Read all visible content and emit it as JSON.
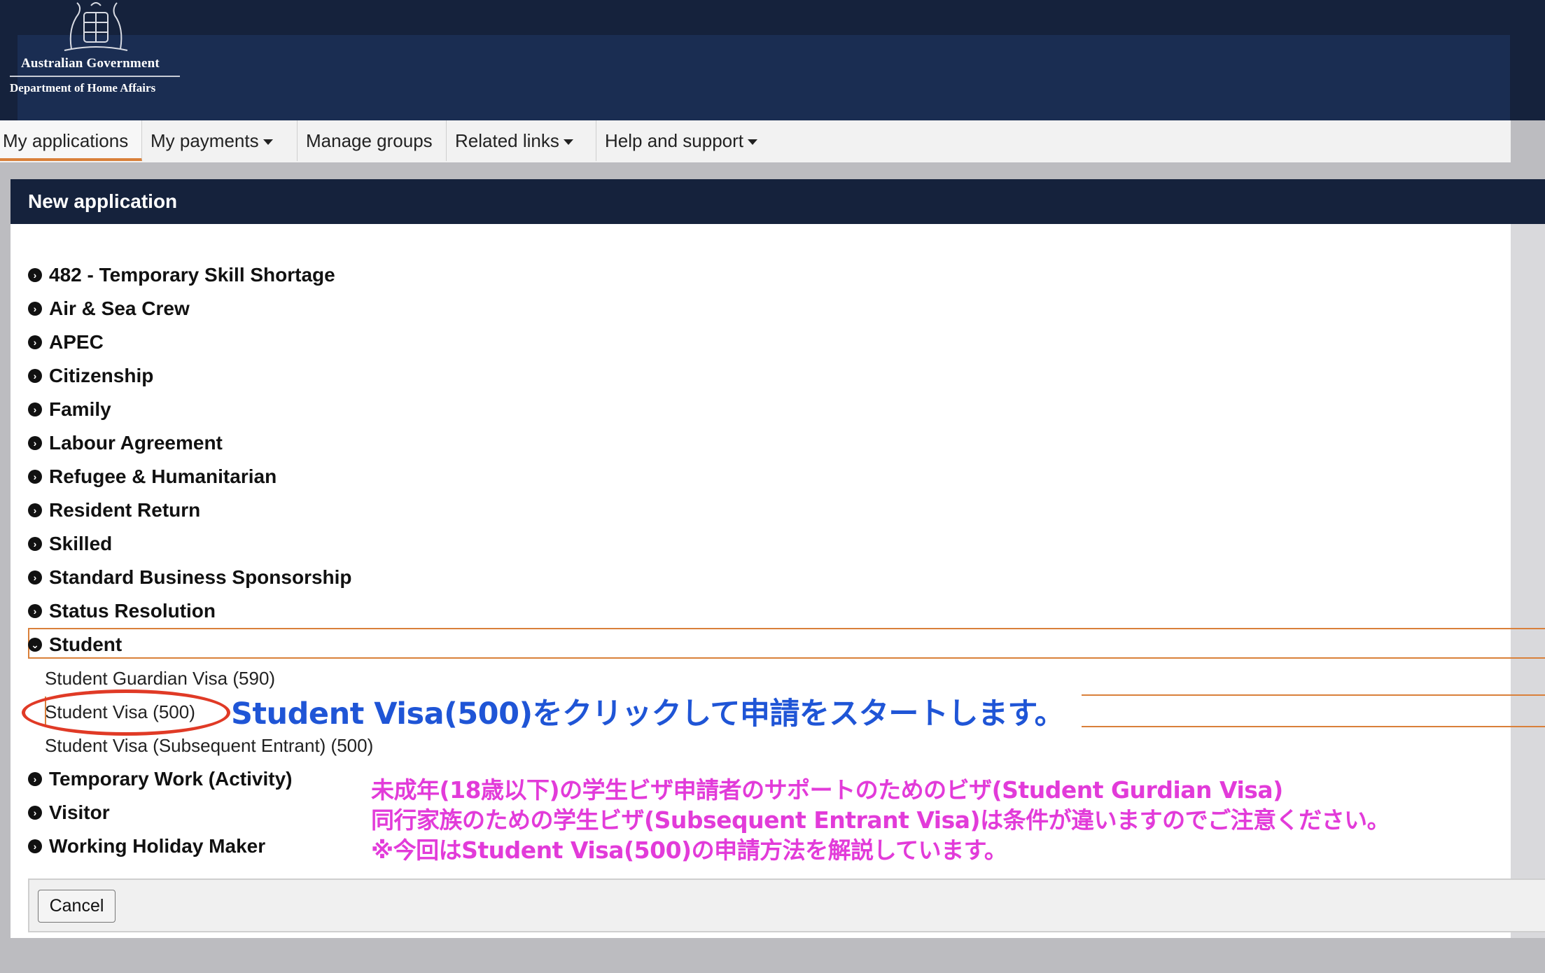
{
  "header": {
    "gov_title": "Australian Government",
    "department": "Department of Home Affairs"
  },
  "nav": {
    "items": [
      {
        "label": "My applications",
        "active": true,
        "dropdown": false
      },
      {
        "label": "My payments",
        "active": false,
        "dropdown": true
      },
      {
        "label": "Manage groups",
        "active": false,
        "dropdown": false
      },
      {
        "label": "Related links",
        "active": false,
        "dropdown": true
      },
      {
        "label": "Help and support",
        "active": false,
        "dropdown": true
      }
    ]
  },
  "panel": {
    "title": "New application",
    "categories": [
      "482 - Temporary Skill Shortage",
      "Air & Sea Crew",
      "APEC",
      "Citizenship",
      "Family",
      "Labour Agreement",
      "Refugee & Humanitarian",
      "Resident Return",
      "Skilled",
      "Standard Business Sponsorship",
      "Status Resolution",
      "Student",
      "Temporary Work (Activity)",
      "Visitor",
      "Working Holiday Maker"
    ],
    "student_subitems": [
      "Student Guardian Visa (590)",
      "Student Visa (500)",
      "Student Visa (Subsequent Entrant) (500)"
    ],
    "cancel_label": "Cancel"
  },
  "annotations": {
    "main": "Student Visa(500)をクリックして申請をスタートします。",
    "note_1": "未成年(18歳以下)の学生ビザ申請者のサポートのためのビザ(Student Gurdian Visa)",
    "note_2": "同行家族のための学生ビザ(Subsequent Entrant Visa)は条件が違いますのでご注意ください。",
    "note_3": "※今回はStudent Visa(500)の申請方法を解説しています。"
  },
  "colors": {
    "header_navy": "#15223c",
    "accent_orange": "#d9803a",
    "annotation_blue": "#1f55d6",
    "annotation_pink": "#e23bd9",
    "highlight_red": "#e03a26"
  },
  "icons": {
    "collapsed": "chevron-circle-right-icon",
    "expanded": "chevron-circle-down-icon",
    "caret": "caret-down-icon",
    "crest": "coat-of-arms-icon"
  }
}
